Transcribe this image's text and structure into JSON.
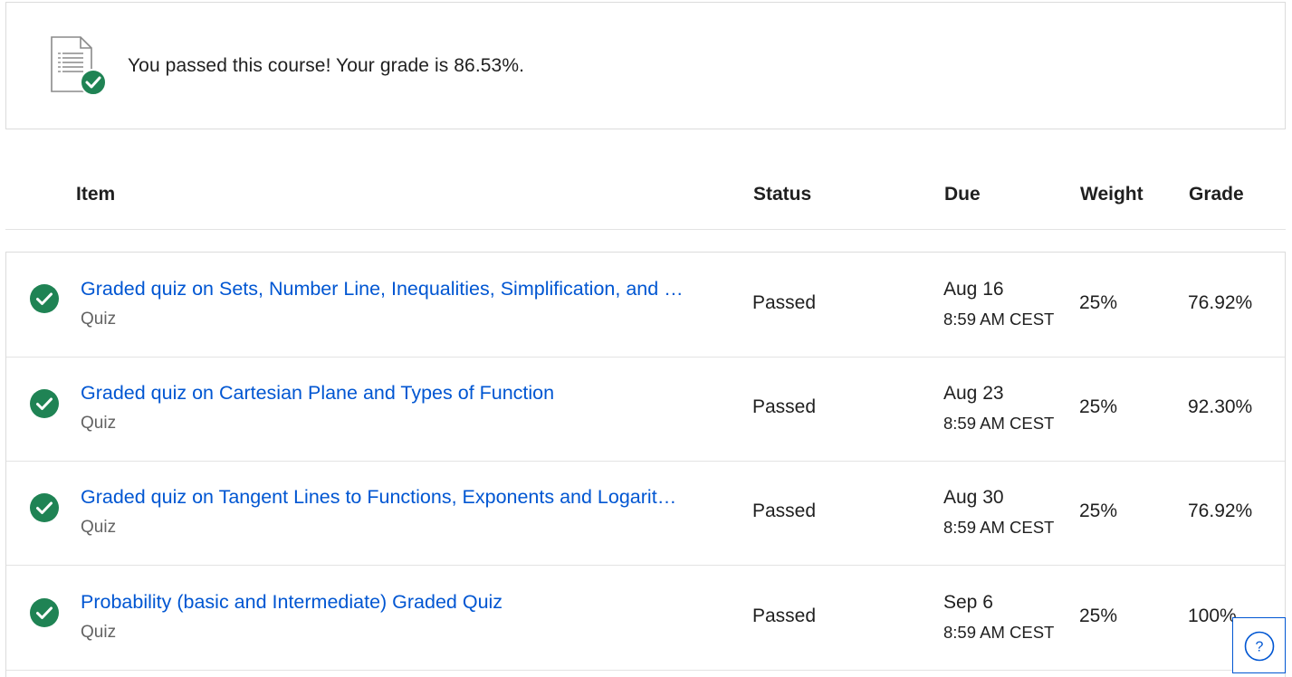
{
  "banner": {
    "message": "You passed this course! Your grade is 86.53%.",
    "icon": "document-check-icon"
  },
  "table": {
    "headers": {
      "item": "Item",
      "status": "Status",
      "due": "Due",
      "weight": "Weight",
      "grade": "Grade"
    },
    "rows": [
      {
        "title": "Graded quiz on Sets, Number Line, Inequalities, Simplification, and Sigma Notation",
        "type": "Quiz",
        "status": "Passed",
        "due_date": "Aug 16",
        "due_time": "8:59 AM CEST",
        "weight": "25%",
        "grade": "76.92%"
      },
      {
        "title": "Graded quiz on Cartesian Plane and Types of Function",
        "type": "Quiz",
        "status": "Passed",
        "due_date": "Aug 23",
        "due_time": "8:59 AM CEST",
        "weight": "25%",
        "grade": "92.30%"
      },
      {
        "title": "Graded quiz on Tangent Lines to Functions, Exponents and Logarithms",
        "type": "Quiz",
        "status": "Passed",
        "due_date": "Aug 30",
        "due_time": "8:59 AM CEST",
        "weight": "25%",
        "grade": "76.92%"
      },
      {
        "title": "Probability (basic and Intermediate) Graded Quiz",
        "type": "Quiz",
        "status": "Passed",
        "due_date": "Sep 6",
        "due_time": "8:59 AM CEST",
        "weight": "25%",
        "grade": "100%"
      }
    ]
  },
  "help": {
    "label": "?",
    "icon": "help-icon"
  },
  "colors": {
    "accent": "#0056d2",
    "success": "#1f8354",
    "text": "#1f1f1f",
    "muted": "#636363"
  }
}
